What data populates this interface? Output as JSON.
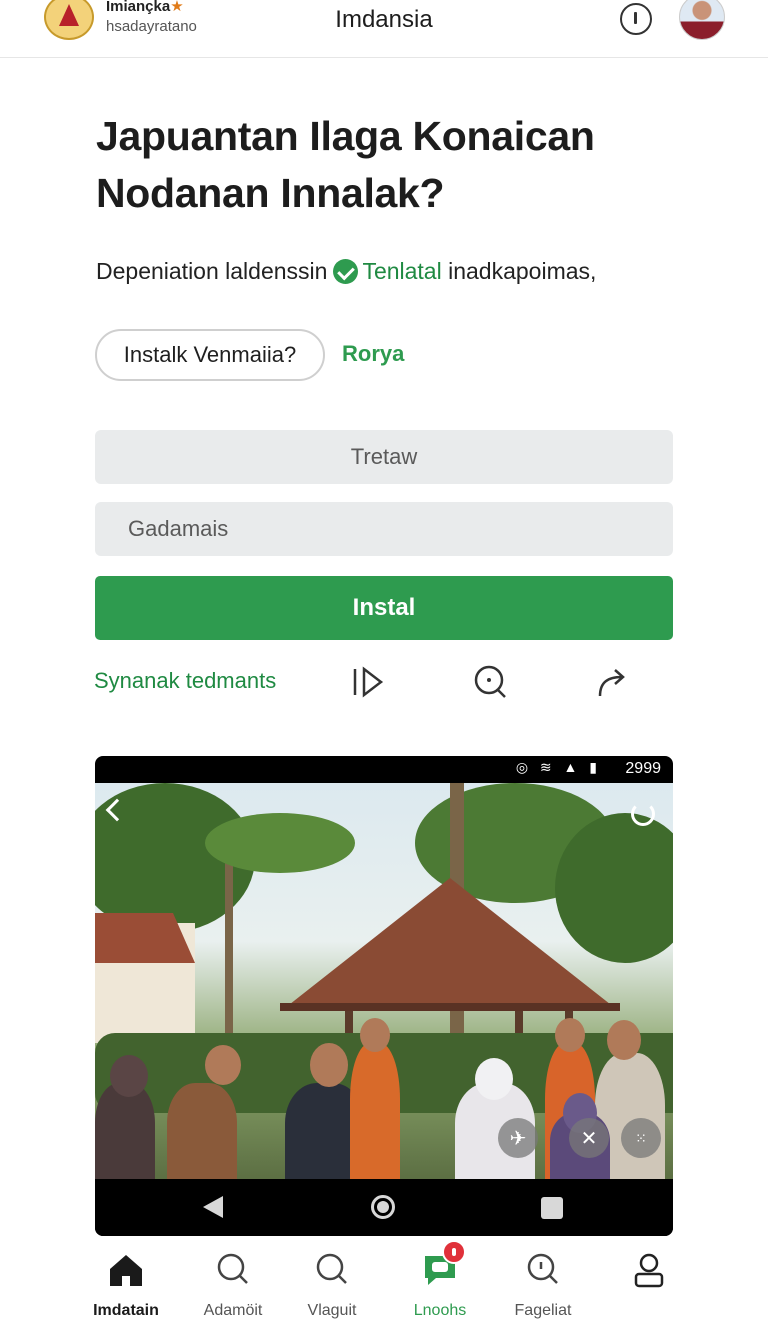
{
  "header": {
    "brand_name": "Imiançka",
    "brand_sub": "hsadayratano",
    "title": "Imdansia"
  },
  "main": {
    "title_line1": "Japuantan Ilaga Konaican",
    "title_line2": "Nodanan Innalak?",
    "subtitle_prefix": "Depeniation laldenssin",
    "subtitle_link": "Tenlatal",
    "subtitle_suffix": "inadkapoimas,",
    "pill_label": "Instalk  Venmaiia?",
    "side_link": "Rorya",
    "field1_value": "Tretaw",
    "field2_placeholder": "Gadamais",
    "install_label": "Instal",
    "action_link": "Synanak tedmants"
  },
  "media": {
    "status_time": "2999",
    "status_icons": "◎ ≋ ▲ ▮"
  },
  "bottom_nav": {
    "items": [
      {
        "label": "Imdatain",
        "icon": "home-icon"
      },
      {
        "label": "Adamöit",
        "icon": "search-icon"
      },
      {
        "label": "Vlaguit",
        "icon": "search-icon"
      },
      {
        "label": "Lnoohs",
        "icon": "chat-icon"
      },
      {
        "label": "Fageliat",
        "icon": "search-icon"
      },
      {
        "label": "",
        "icon": "profile-icon"
      }
    ]
  },
  "colors": {
    "accent_green": "#2e9b4f",
    "field_bg": "#e9ebec",
    "badge_red": "#e0313a"
  }
}
